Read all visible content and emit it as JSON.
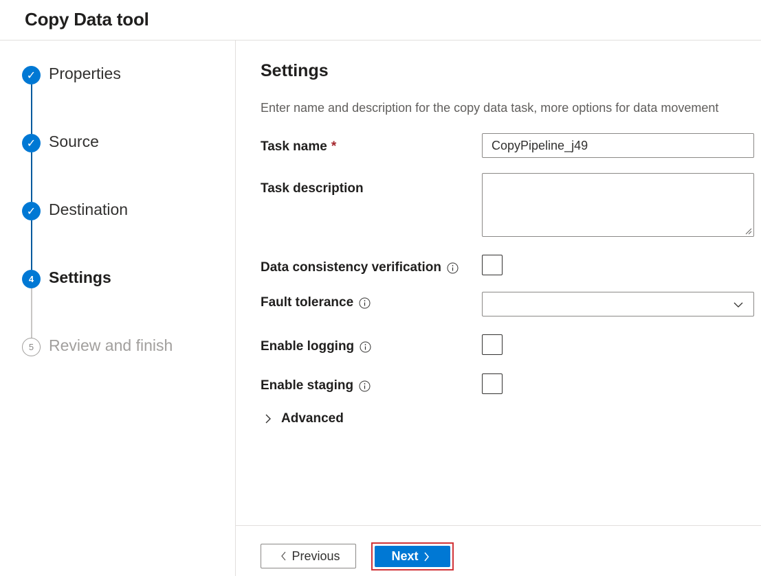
{
  "header": {
    "title": "Copy Data tool"
  },
  "steps": [
    {
      "label": "Properties",
      "state": "done",
      "marker": "✓"
    },
    {
      "label": "Source",
      "state": "done",
      "marker": "✓"
    },
    {
      "label": "Destination",
      "state": "done",
      "marker": "✓"
    },
    {
      "label": "Settings",
      "state": "current",
      "marker": "4"
    },
    {
      "label": "Review and finish",
      "state": "todo",
      "marker": "5"
    }
  ],
  "settings": {
    "title": "Settings",
    "description": "Enter name and description for the copy data task, more options for data movement",
    "task_name_label": "Task name",
    "required_marker": "*",
    "task_name_value": "CopyPipeline_j49",
    "task_description_label": "Task description",
    "task_description_value": "",
    "data_consistency_label": "Data consistency verification",
    "data_consistency_checked": false,
    "fault_tolerance_label": "Fault tolerance",
    "fault_tolerance_value": "",
    "enable_logging_label": "Enable logging",
    "enable_logging_checked": false,
    "enable_staging_label": "Enable staging",
    "enable_staging_checked": false,
    "advanced_label": "Advanced"
  },
  "footer": {
    "previous_label": "Previous",
    "next_label": "Next"
  },
  "colors": {
    "accent": "#0078d4",
    "highlight_outline": "#d13438",
    "required": "#a4262c"
  },
  "icons": {
    "info": "info-icon",
    "chevron_down": "chevron-down-icon",
    "chevron_right": "chevron-right-icon",
    "chevron_left": "chevron-left-icon",
    "checkmark": "checkmark-icon"
  }
}
